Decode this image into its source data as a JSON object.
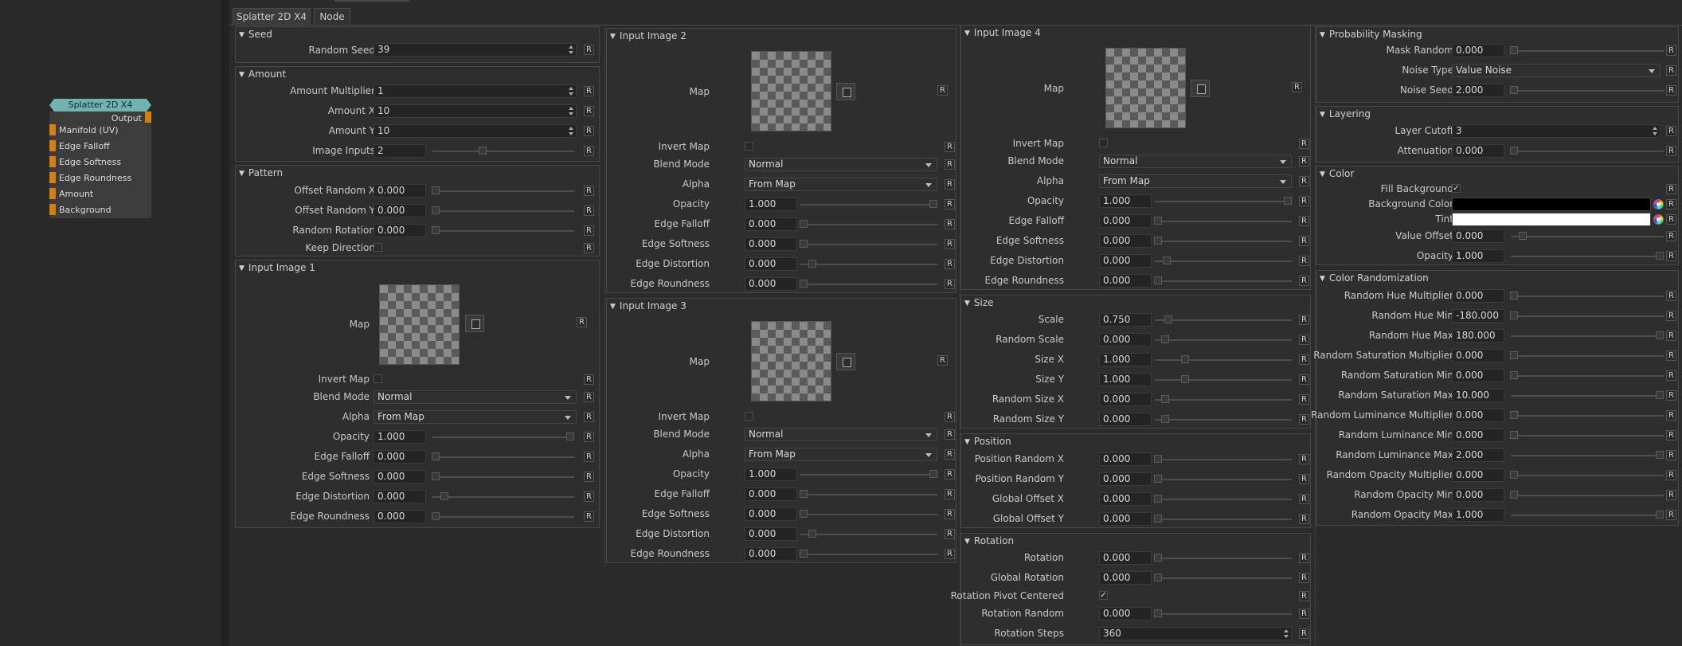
{
  "tabs": [
    "Splatter 2D X4",
    "Node"
  ],
  "node": {
    "title": "Splatter 2D X4",
    "output": "Output",
    "inputs": [
      "Manifold (UV)",
      "Edge Falloff",
      "Edge Softness",
      "Edge Roundness",
      "Amount",
      "Background"
    ]
  },
  "reset": "R",
  "check": "✓",
  "colors": {
    "node_header": "#6fb4b0",
    "port": "#d4800f",
    "background_color": "#000000",
    "tint": "#ffffff"
  },
  "seed": {
    "title": "Seed",
    "random_seed_label": "Random Seed",
    "random_seed": "39"
  },
  "amount": {
    "title": "Amount",
    "multiplier_label": "Amount Multiplier",
    "multiplier": "1",
    "x_label": "Amount X",
    "x": "10",
    "y_label": "Amount Y",
    "y": "10",
    "inputs_label": "Image Inputs",
    "inputs": "2"
  },
  "pattern": {
    "title": "Pattern",
    "offx_label": "Offset Random X",
    "offx": "0.000",
    "offy_label": "Offset Random Y",
    "offy": "0.000",
    "rot_label": "Random Rotation",
    "rot": "0.000",
    "keep_label": "Keep Direction"
  },
  "img_labels": {
    "map": "Map",
    "invert": "Invert Map",
    "blend": "Blend Mode",
    "alpha": "Alpha",
    "opacity": "Opacity",
    "falloff": "Edge Falloff",
    "softness": "Edge Softness",
    "distortion": "Edge Distortion",
    "roundness": "Edge Roundness"
  },
  "img1": {
    "title": "Input Image 1",
    "blend": "Normal",
    "alpha": "From Map",
    "opacity": "1.000",
    "falloff": "0.000",
    "softness": "0.000",
    "distortion": "0.000",
    "roundness": "0.000"
  },
  "img2": {
    "title": "Input Image 2",
    "blend": "Normal",
    "alpha": "From Map",
    "opacity": "1.000",
    "falloff": "0.000",
    "softness": "0.000",
    "distortion": "0.000",
    "roundness": "0.000"
  },
  "img3": {
    "title": "Input Image 3",
    "blend": "Normal",
    "alpha": "From Map",
    "opacity": "1.000",
    "falloff": "0.000",
    "softness": "0.000",
    "distortion": "0.000",
    "roundness": "0.000"
  },
  "img4": {
    "title": "Input Image 4",
    "blend": "Normal",
    "alpha": "From Map",
    "opacity": "1.000",
    "falloff": "0.000",
    "softness": "0.000",
    "distortion": "0.000",
    "roundness": "0.000"
  },
  "size": {
    "title": "Size",
    "scale_label": "Scale",
    "scale": "0.750",
    "rscale_label": "Random Scale",
    "rscale": "0.000",
    "sx_label": "Size X",
    "sx": "1.000",
    "sy_label": "Size Y",
    "sy": "1.000",
    "rsx_label": "Random Size X",
    "rsx": "0.000",
    "rsy_label": "Random Size Y",
    "rsy": "0.000"
  },
  "position": {
    "title": "Position",
    "prx_label": "Position Random X",
    "prx": "0.000",
    "pry_label": "Position Random Y",
    "pry": "0.000",
    "gox_label": "Global Offset X",
    "gox": "0.000",
    "goy_label": "Global Offset Y",
    "goy": "0.000"
  },
  "rotation": {
    "title": "Rotation",
    "rot_label": "Rotation",
    "rot": "0.000",
    "grot_label": "Global Rotation",
    "grot": "0.000",
    "pivot_label": "Rotation Pivot Centered",
    "rrand_label": "Rotation Random",
    "rrand": "0.000",
    "steps_label": "Rotation Steps",
    "steps": "360"
  },
  "prob": {
    "title": "Probability Masking",
    "mask_label": "Mask Random",
    "mask": "0.000",
    "noise_label": "Noise Type",
    "noise": "Value Noise",
    "nseed_label": "Noise Seed",
    "nseed": "2.000"
  },
  "layering": {
    "title": "Layering",
    "cutoff_label": "Layer Cutoff",
    "cutoff": "3",
    "atten_label": "Attenuation",
    "atten": "0.000"
  },
  "color": {
    "title": "Color",
    "fill_label": "Fill Background",
    "bg_label": "Background Color",
    "tint_label": "Tint",
    "voff_label": "Value Offset",
    "voff": "0.000",
    "opacity_label": "Opacity",
    "opacity": "1.000"
  },
  "crand": {
    "title": "Color Randomization",
    "rows": [
      {
        "label": "Random Hue Multiplier",
        "value": "0.000"
      },
      {
        "label": "Random Hue Min",
        "value": "-180.000"
      },
      {
        "label": "Random Hue Max",
        "value": "180.000"
      },
      {
        "label": "Random Saturation Multiplier",
        "value": "0.000"
      },
      {
        "label": "Random Saturation Min",
        "value": "0.000"
      },
      {
        "label": "Random Saturation Max",
        "value": "10.000"
      },
      {
        "label": "Random Luminance Multiplier",
        "value": "0.000"
      },
      {
        "label": "Random Luminance Min",
        "value": "0.000"
      },
      {
        "label": "Random Luminance Max",
        "value": "2.000"
      },
      {
        "label": "Random Opacity Multiplier",
        "value": "0.000"
      },
      {
        "label": "Random Opacity Min",
        "value": "0.000"
      },
      {
        "label": "Random Opacity Max",
        "value": "1.000"
      }
    ]
  }
}
